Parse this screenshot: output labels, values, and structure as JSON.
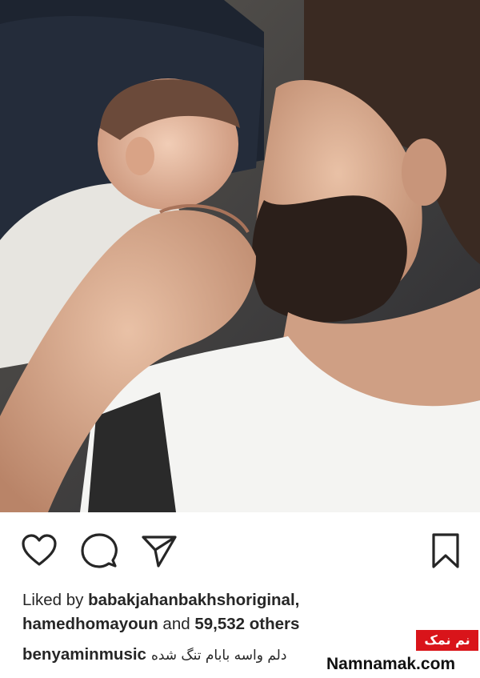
{
  "post": {
    "image_alt": "Bearded man lying beside a sleeping newborn baby",
    "likes": {
      "prefix": "Liked by",
      "user1": "babakjahanbakhshoriginal,",
      "user2": "hamedhomayoun",
      "middle": "and",
      "count": "59,532 others"
    },
    "caption": {
      "username": "benyaminmusic",
      "text": "دلم واسه بابام تنگ شده"
    }
  },
  "actions": {
    "like_icon": "heart-icon",
    "comment_icon": "comment-icon",
    "share_icon": "send-icon",
    "save_icon": "bookmark-icon"
  },
  "watermark": {
    "badge": "نم نمک",
    "site": "Namnamak.com"
  },
  "colors": {
    "badge": "#d9141a",
    "text": "#262626"
  }
}
